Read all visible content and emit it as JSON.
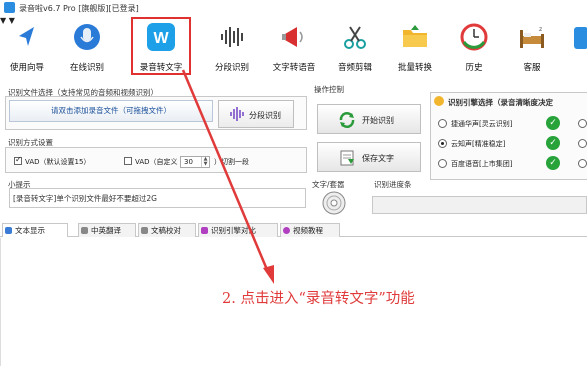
{
  "window": {
    "title": "录音啦v6.7 Pro [旗舰版][已登录]"
  },
  "toolbar": {
    "items": [
      {
        "label": "使用向导",
        "icon": "navigation-arrow-icon"
      },
      {
        "label": "在线识别",
        "icon": "microphone-icon"
      },
      {
        "label": "录音转文字",
        "icon": "w-logo-icon"
      },
      {
        "label": "分段识别",
        "icon": "waveform-icon"
      },
      {
        "label": "文字转语音",
        "icon": "megaphone-icon"
      },
      {
        "label": "音频剪辑",
        "icon": "scissors-icon"
      },
      {
        "label": "批量转换",
        "icon": "folder-icon"
      },
      {
        "label": "历史",
        "icon": "clock-gauge-icon"
      },
      {
        "label": "客服",
        "icon": "bed-icon"
      }
    ]
  },
  "file_select": {
    "title": "识别文件选择（支持常见的音频和视频识别）",
    "add_button": "请双击添加录音文件（可拖拽文件）",
    "segment_button": "分段识别"
  },
  "mode": {
    "title": "识别方式设置",
    "vad_default": "VAD（默认设置15）",
    "vad_custom": "VAD（自定义",
    "vad_value": "30",
    "vad_suffix": "）切割一段"
  },
  "tip": {
    "title": "小提示",
    "text": "[录音转文字]单个识别文件最好不要超过2G"
  },
  "operation": {
    "title": "操作控制",
    "start": "开始识别",
    "save": "保存文字"
  },
  "text_pad": {
    "title": "文字/套嚣"
  },
  "progress": {
    "title": "识别进度条"
  },
  "engine": {
    "title": "识别引擎选择（录音清晰度决定",
    "options": [
      {
        "label": "捷通华声[灵云识别]",
        "selected": false
      },
      {
        "label": "云知声[精准稳定]",
        "selected": true
      },
      {
        "label": "百度语音[上市集团]",
        "selected": false
      }
    ]
  },
  "tabs": [
    {
      "label": "文本显示",
      "active": true,
      "color": "#3a7bd5"
    },
    {
      "label": "中英翻译",
      "active": false,
      "color": "#888888"
    },
    {
      "label": "文稿校对",
      "active": false,
      "color": "#888888"
    },
    {
      "label": "识别引擎对比",
      "active": false,
      "color": "#b040c0"
    },
    {
      "label": "视频教程",
      "active": false,
      "color": "#b040c0"
    }
  ],
  "annotation": {
    "text": "2. 点击进入“录音转文字”功能"
  },
  "colors": {
    "highlight": "#e03030",
    "annotation": "#e03a3a",
    "ok": "#27a33a",
    "accent": "#2a8de0"
  }
}
